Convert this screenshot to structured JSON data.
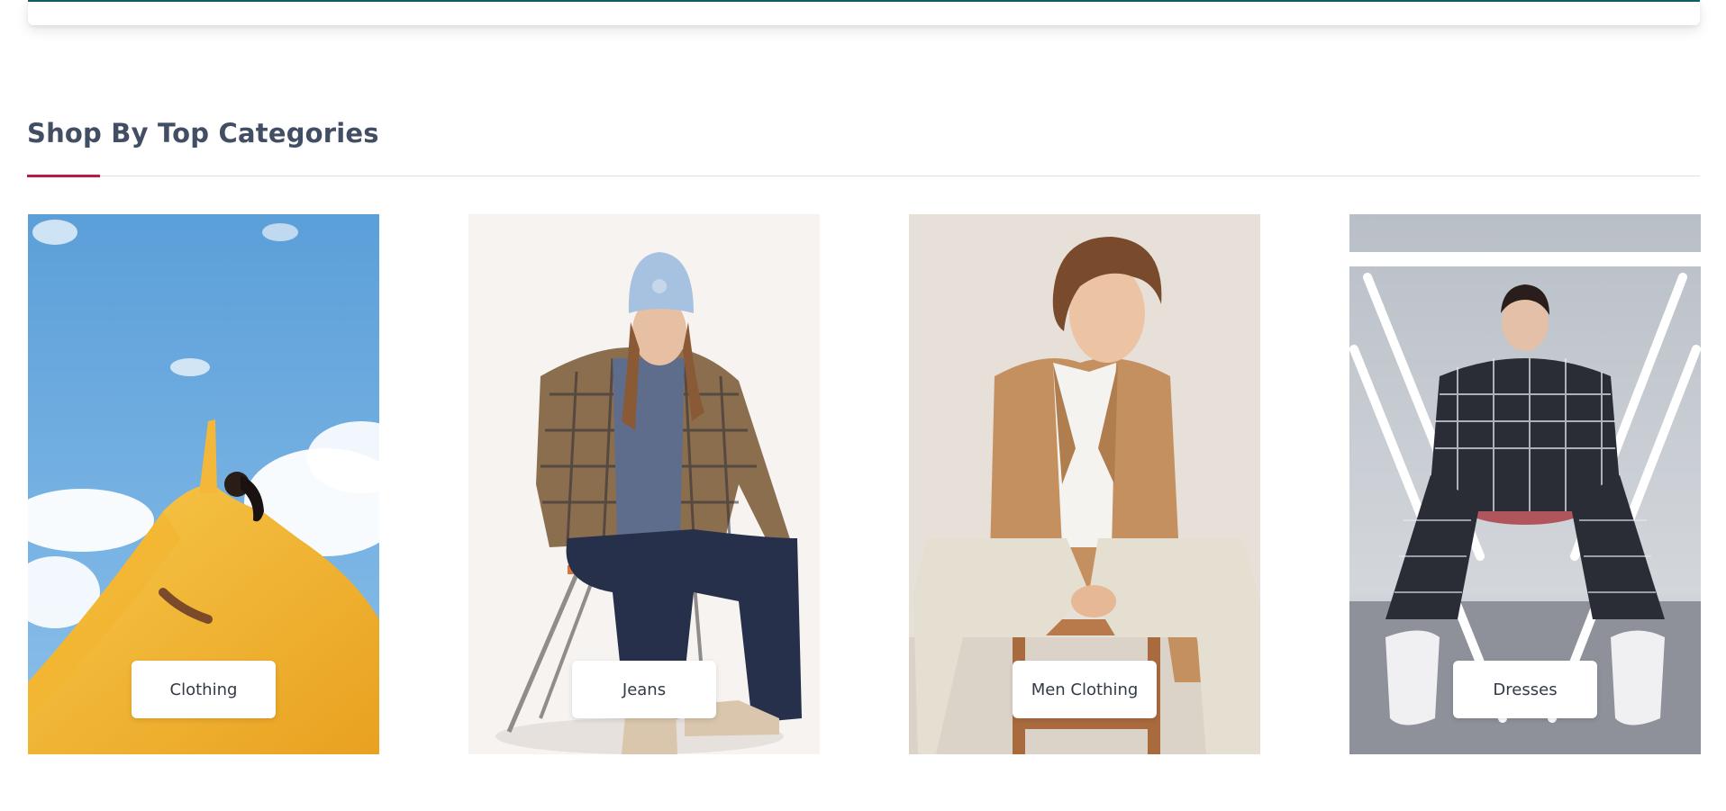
{
  "section": {
    "title": "Shop By Top Categories"
  },
  "theme": {
    "accent": "#b91c45",
    "header_border": "#0f5e63",
    "title_color": "#414e63"
  },
  "categories": [
    {
      "label": "Clothing"
    },
    {
      "label": "Jeans"
    },
    {
      "label": "Men Clothing"
    },
    {
      "label": "Dresses"
    }
  ]
}
